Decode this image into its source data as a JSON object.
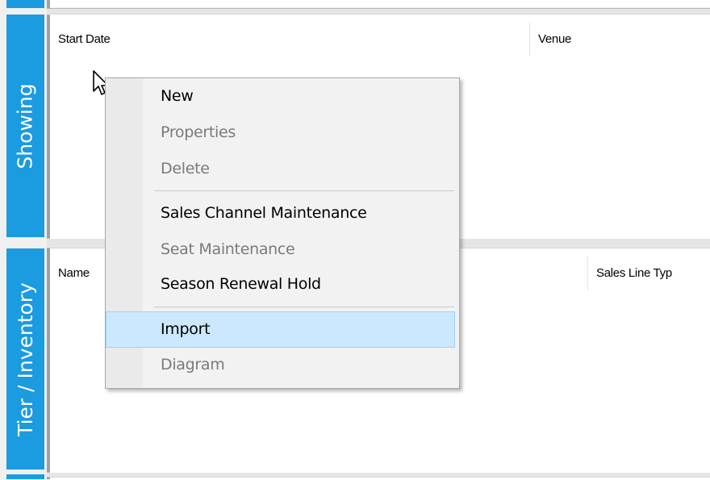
{
  "side_tabs": {
    "showing": "Showing",
    "tier_inventory": "Tier / Inventory"
  },
  "showing_panel": {
    "columns": [
      "Start Date",
      "Venue"
    ]
  },
  "tier_panel": {
    "columns": [
      "Name",
      "Sales Line Typ"
    ]
  },
  "context_menu": {
    "items": [
      {
        "label": "New",
        "enabled": true
      },
      {
        "label": "Properties",
        "enabled": false
      },
      {
        "label": "Delete",
        "enabled": false
      },
      {
        "label": "Sales Channel Maintenance",
        "enabled": true
      },
      {
        "label": "Seat Maintenance",
        "enabled": false
      },
      {
        "label": "Season Renewal Hold",
        "enabled": true
      },
      {
        "label": "Import",
        "enabled": true,
        "highlighted": true
      },
      {
        "label": "Diagram",
        "enabled": false
      }
    ]
  },
  "colors": {
    "side_tab": "#1b9be0",
    "menu_highlight": "#cce8ff",
    "menu_highlight_border": "#99d1ff"
  },
  "icons": {
    "cursor": "arrow-pointer-icon"
  }
}
